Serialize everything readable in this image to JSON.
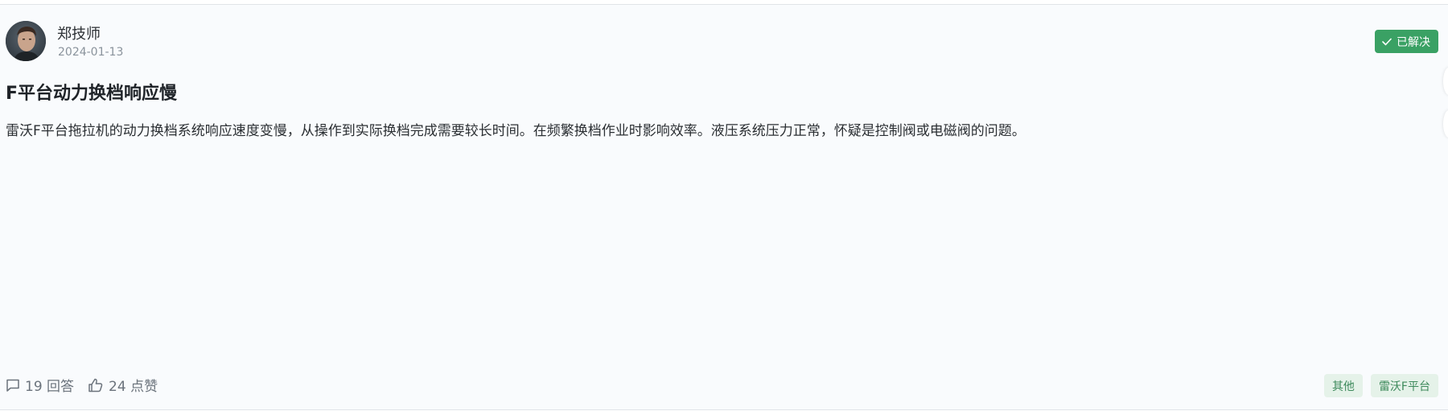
{
  "post": {
    "author": {
      "name": "郑技师",
      "date": "2024-01-13",
      "avatar_icon": "person-photo-avatar"
    },
    "status": {
      "label": "已解决",
      "icon": "check-icon",
      "color": "#3aa164"
    },
    "title": "F平台动力换档响应慢",
    "body": "雷沃F平台拖拉机的动力换档系统响应速度变慢，从操作到实际换档完成需要较长时间。在频繁换档作业时影响效率。液压系统压力正常，怀疑是控制阀或电磁阀的问题。",
    "stats": {
      "answers_label": "19 回答",
      "answers_icon": "comment-icon",
      "likes_label": "24 点赞",
      "likes_icon": "thumbs-up-icon"
    },
    "tags": [
      "其他",
      "雷沃F平台"
    ]
  }
}
